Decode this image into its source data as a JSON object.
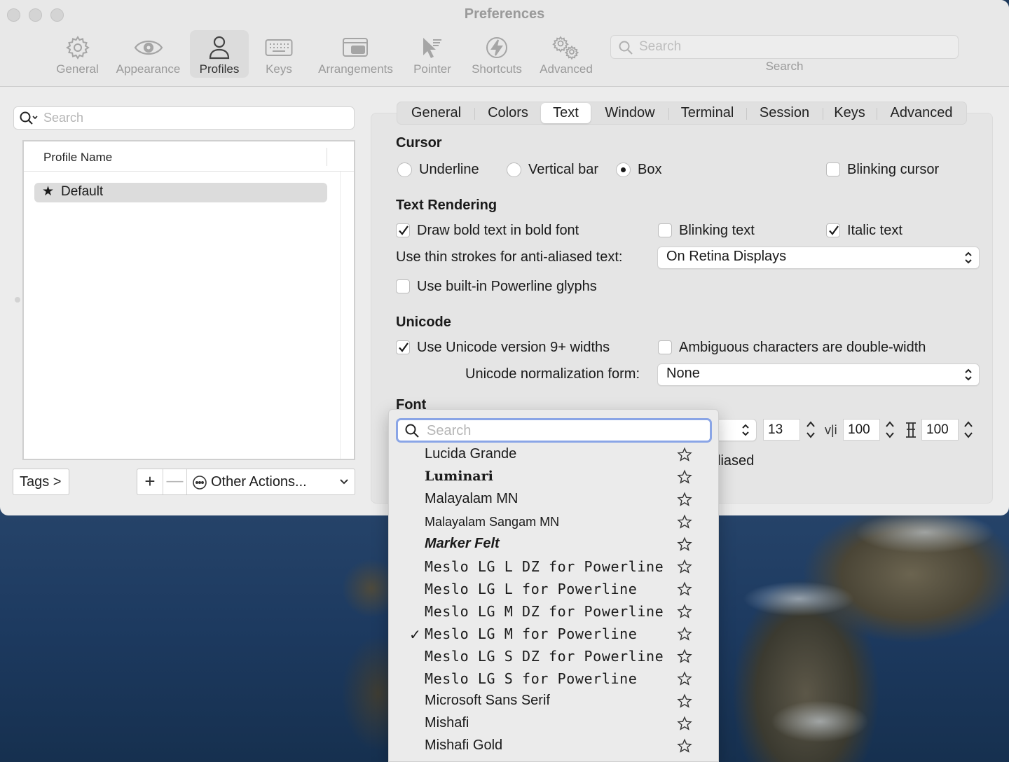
{
  "window": {
    "title": "Preferences"
  },
  "toolbar": {
    "items": [
      {
        "label": "General",
        "icon": "gear-icon"
      },
      {
        "label": "Appearance",
        "icon": "eye-icon"
      },
      {
        "label": "Profiles",
        "icon": "person-icon",
        "active": true
      },
      {
        "label": "Keys",
        "icon": "keyboard-icon"
      },
      {
        "label": "Arrangements",
        "icon": "windows-icon"
      },
      {
        "label": "Pointer",
        "icon": "pointer-icon"
      },
      {
        "label": "Shortcuts",
        "icon": "bolt-icon"
      },
      {
        "label": "Advanced",
        "icon": "gears-icon"
      }
    ],
    "search_placeholder": "Search",
    "search_label": "Search"
  },
  "profiles": {
    "search_placeholder": "Search",
    "column_header": "Profile Name",
    "rows": [
      {
        "name": "Default",
        "star": "★"
      }
    ],
    "tags_button": "Tags >",
    "add_symbol": "+",
    "remove_symbol": "—",
    "other_actions": "Other Actions..."
  },
  "tabs": [
    "General",
    "Colors",
    "Text",
    "Window",
    "Terminal",
    "Session",
    "Keys",
    "Advanced"
  ],
  "active_tab": "Text",
  "cursor": {
    "heading": "Cursor",
    "underline": "Underline",
    "vertical_bar": "Vertical bar",
    "box": "Box",
    "selected": "Box",
    "blinking": "Blinking cursor",
    "blinking_checked": false
  },
  "text_rendering": {
    "heading": "Text Rendering",
    "bold": "Draw bold text in bold font",
    "bold_checked": true,
    "blinking_text": "Blinking text",
    "blinking_text_checked": false,
    "italic": "Italic text",
    "italic_checked": true,
    "thin_strokes_label": "Use thin strokes for anti-aliased text:",
    "thin_strokes_value": "On Retina Displays",
    "powerline": "Use built-in Powerline glyphs",
    "powerline_checked": false
  },
  "unicode": {
    "heading": "Unicode",
    "widths": "Use Unicode version 9+ widths",
    "widths_checked": true,
    "ambiguous": "Ambiguous characters are double-width",
    "ambiguous_checked": false,
    "normalization_label": "Unicode normalization form:",
    "normalization_value": "None"
  },
  "font": {
    "heading": "Font",
    "size": "13",
    "hspacing_icon": "v|i",
    "hspacing": "100",
    "vspacing": "100",
    "antialiased_partial": "liased"
  },
  "font_popup": {
    "search_placeholder": "Search",
    "selected": "Meslo LG M for Powerline",
    "check_mark": "✓",
    "items": [
      "Lucida Grande",
      "Luminari",
      "Malayalam MN",
      "Malayalam Sangam MN",
      "Marker Felt",
      "Meslo LG L DZ for Powerline",
      "Meslo LG L for Powerline",
      "Meslo LG M DZ for Powerline",
      "Meslo LG M for Powerline",
      "Meslo LG S DZ for Powerline",
      "Meslo LG S for Powerline",
      "Microsoft Sans Serif",
      "Mishafi",
      "Mishafi Gold"
    ]
  }
}
